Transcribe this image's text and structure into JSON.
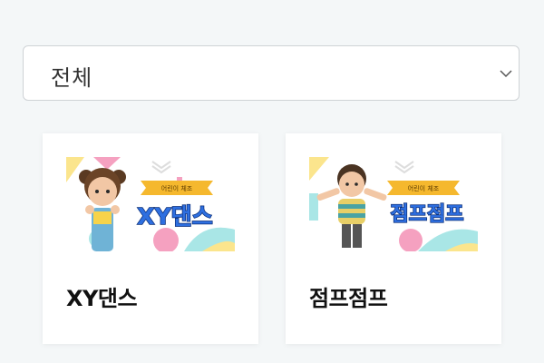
{
  "filter": {
    "selected": "전체"
  },
  "cards": [
    {
      "title": "XY댄스",
      "thumbnail": {
        "banner": "어린이 체조",
        "title": "XY댄스"
      }
    },
    {
      "title": "점프점프",
      "thumbnail": {
        "banner": "어린이 체조",
        "title": "점프점프"
      }
    }
  ],
  "colors": {
    "background": "#f4f7f8",
    "banner": "#f5b82e",
    "thumb_title_fill": "#2e6fe0",
    "thumb_title_stroke": "#0b2e78",
    "pink": "#f5a1c0",
    "aqua": "#a9e6e6",
    "yellow": "#fbe58d"
  }
}
